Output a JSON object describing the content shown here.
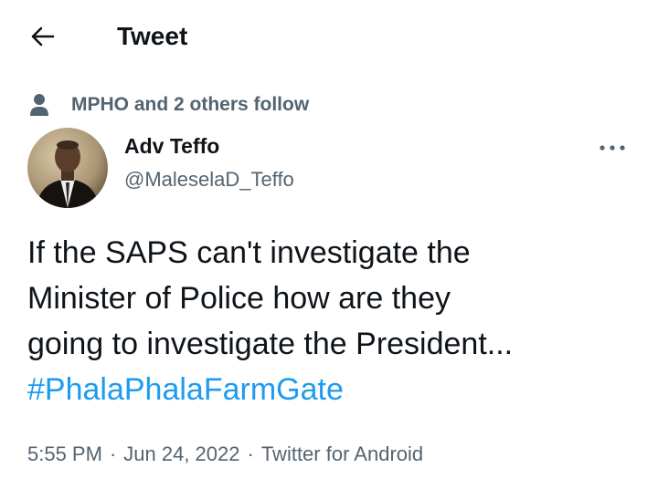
{
  "header": {
    "title": "Tweet",
    "back_icon": "arrow-left-icon"
  },
  "social_context": {
    "icon": "person-icon",
    "text": "MPHO and 2 others follow"
  },
  "author": {
    "name": "Adv Teffo",
    "handle": "@MaleselaD_Teffo"
  },
  "more_icon": "more-options-icon",
  "tweet": {
    "lines": [
      "If the SAPS can't investigate the",
      "Minister of Police how are they",
      "going to investigate the President..."
    ],
    "hashtag": "#PhalaPhalaFarmGate"
  },
  "meta": {
    "time": "5:55 PM",
    "separator": "·",
    "date": "Jun 24, 2022",
    "source": "Twitter for Android"
  },
  "colors": {
    "text": "#0f1419",
    "secondary": "#536471",
    "link": "#1d9bf0"
  }
}
